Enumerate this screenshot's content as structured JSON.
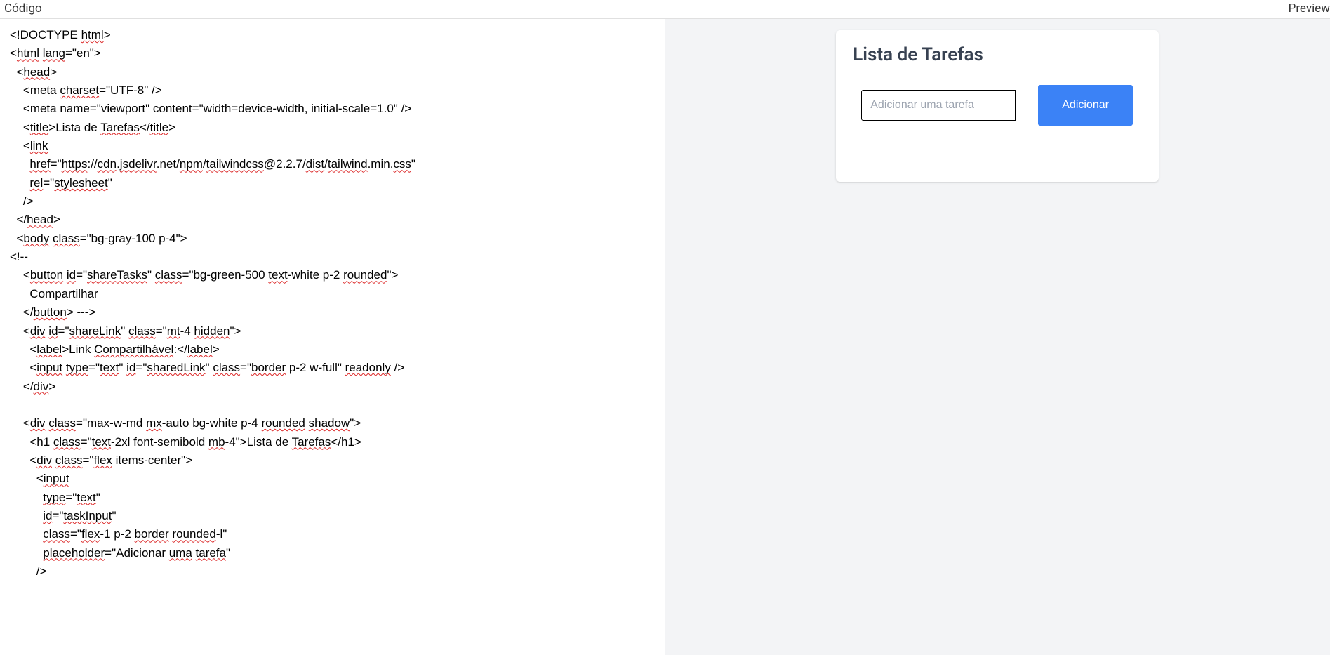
{
  "left": {
    "header": "Código",
    "code_lines": [
      "<!DOCTYPE html>",
      "<html lang=\"en\">",
      "  <head>",
      "    <meta charset=\"UTF-8\" />",
      "    <meta name=\"viewport\" content=\"width=device-width, initial-scale=1.0\" />",
      "    <title>Lista de Tarefas</title>",
      "    <link",
      "      href=\"https://cdn.jsdelivr.net/npm/tailwindcss@2.2.7/dist/tailwind.min.css\"",
      "      rel=\"stylesheet\"",
      "    />",
      "  </head>",
      "  <body class=\"bg-gray-100 p-4\">",
      "<!--",
      "    <button id=\"shareTasks\" class=\"bg-green-500 text-white p-2 rounded\">",
      "      Compartilhar",
      "    </button> --->",
      "    <div id=\"shareLink\" class=\"mt-4 hidden\">",
      "      <label>Link Compartilhável:</label>",
      "      <input type=\"text\" id=\"sharedLink\" class=\"border p-2 w-full\" readonly />",
      "    </div>",
      "",
      "    <div class=\"max-w-md mx-auto bg-white p-4 rounded shadow\">",
      "      <h1 class=\"text-2xl font-semibold mb-4\">Lista de Tarefas</h1>",
      "      <div class=\"flex items-center\">",
      "        <input",
      "          type=\"text\"",
      "          id=\"taskInput\"",
      "          class=\"flex-1 p-2 border rounded-l\"",
      "          placeholder=\"Adicionar uma tarefa\"",
      "        />"
    ],
    "squiggle_words": [
      "html",
      "lang",
      "charset",
      "title",
      "Tarefas",
      "title",
      "link",
      "href",
      "https",
      "cdn",
      "jsdelivr",
      "npm",
      "tailwindcss",
      "dist",
      "tailwind",
      "css",
      "rel",
      "stylesheet",
      "head",
      "body",
      "class",
      "bg-gray",
      "button",
      "id",
      "shareTasks",
      "bg-green",
      "text-white",
      "rounded",
      "button",
      "div",
      "shareLink",
      "mt",
      "hidden",
      "label",
      "Compartilhável",
      "label",
      "input",
      "type",
      "text",
      "sharedLink",
      "border",
      "w-full",
      "readonly",
      "div",
      "max-w-md",
      "mx",
      "bg-white",
      "rounded",
      "shadow",
      "text",
      "font-semibold",
      "mb",
      "Tarefas",
      "flex",
      "items-center",
      "input",
      "type",
      "text",
      "id",
      "taskInput",
      "flex",
      "border",
      "rounded",
      "placeholder",
      "uma",
      "tarefa"
    ]
  },
  "right": {
    "header": "Preview",
    "card": {
      "title": "Lista de Tarefas",
      "input_placeholder": "Adicionar uma tarefa",
      "button_label": "Adicionar"
    }
  }
}
